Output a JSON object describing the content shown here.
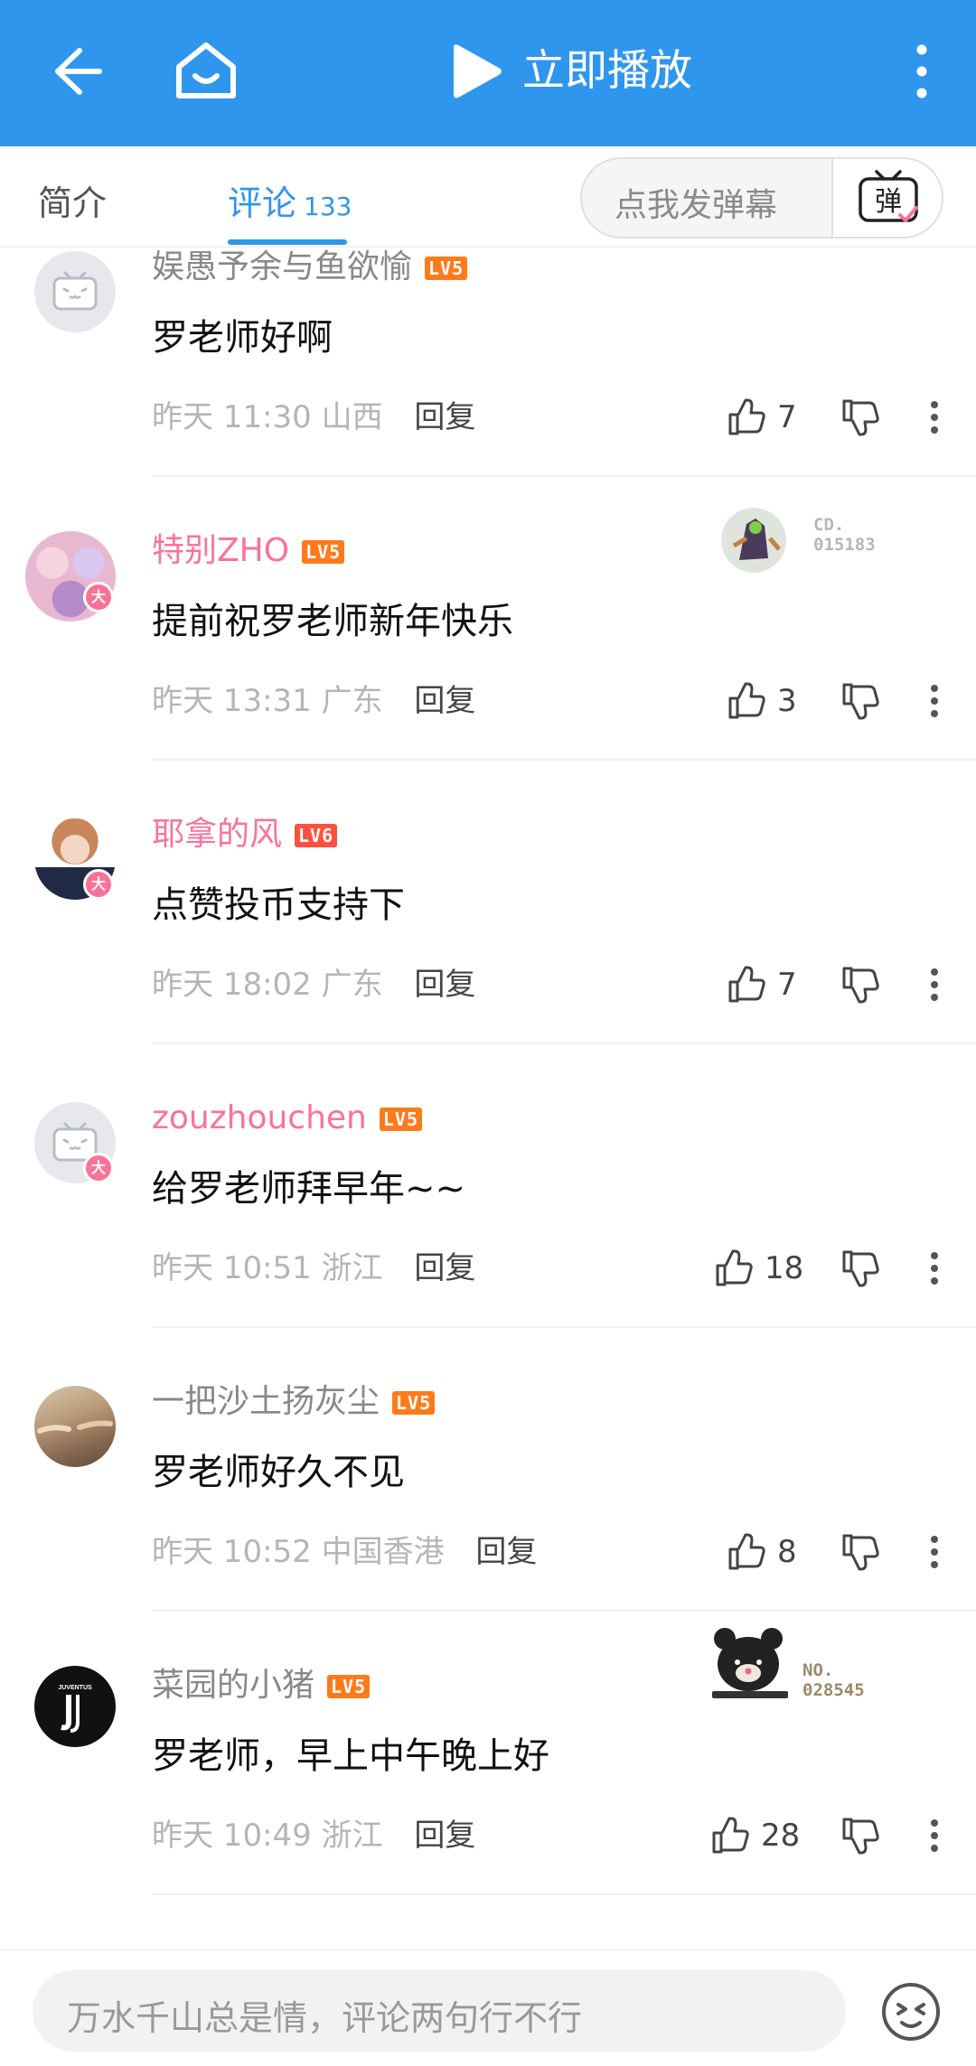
{
  "topbar": {
    "play_label": "立即播放"
  },
  "tabs": {
    "intro": "简介",
    "comments": "评论",
    "comments_count": "133"
  },
  "danmaku": {
    "placeholder": "点我发弹幕",
    "icon_char": "弹"
  },
  "comments": [
    {
      "username": "娱愚予余与鱼欲愉",
      "level": "LV5",
      "text": "罗老师好啊",
      "time": "昨天 11:30",
      "location": "山西",
      "reply": "回复",
      "likes": "7"
    },
    {
      "username": "特别ZHO",
      "level": "LV5",
      "vip_badge": "大",
      "text": "提前祝罗老师新年快乐",
      "time": "昨天 13:31",
      "location": "广东",
      "reply": "回复",
      "likes": "3",
      "fan_prefix": "CD.",
      "fan_number": "015183"
    },
    {
      "username": "耶拿的风",
      "level": "LV6",
      "vip_badge": "大",
      "text": "点赞投币支持下",
      "time": "昨天 18:02",
      "location": "广东",
      "reply": "回复",
      "likes": "7"
    },
    {
      "username": "zouzhouchen",
      "level": "LV5",
      "vip_badge": "大",
      "text": "给罗老师拜早年~~",
      "time": "昨天 10:51",
      "location": "浙江",
      "reply": "回复",
      "likes": "18"
    },
    {
      "username": "一把沙土扬灰尘",
      "level": "LV5",
      "text": "罗老师好久不见",
      "time": "昨天 10:52",
      "location": "中国香港",
      "reply": "回复",
      "likes": "8"
    },
    {
      "username": "菜园的小猪",
      "level": "LV5",
      "text": "罗老师，早上中午晚上好",
      "time": "昨天 10:49",
      "location": "浙江",
      "reply": "回复",
      "likes": "28",
      "fan_prefix": "NO.",
      "fan_number": "028545",
      "avatar_text": "JUVENTUS"
    }
  ],
  "bottom": {
    "placeholder": "万水千山总是情，评论两句行不行"
  },
  "colors": {
    "brand_blue": "#2f96ee",
    "vip_pink": "#fb7299",
    "level_orange": "#ff7a1a",
    "level_red": "#ff4f3f"
  }
}
